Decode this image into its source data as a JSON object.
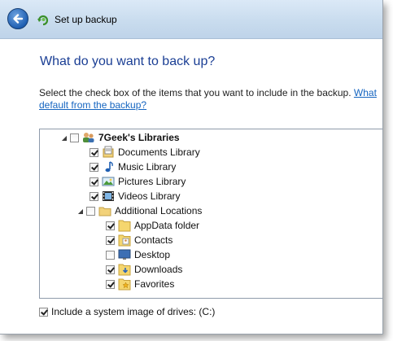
{
  "window": {
    "title": "Set up backup"
  },
  "main": {
    "heading": "What do you want to back up?",
    "instruction": "Select the check box of the items that you want to include in the backup.",
    "link_part1": "What",
    "link_part2": "default from the backup?"
  },
  "tree": {
    "root": {
      "label": "7Geek's Libraries",
      "checked": false,
      "expanded": true,
      "icon": "users-icon"
    },
    "libraries": [
      {
        "label": "Documents Library",
        "checked": true,
        "icon": "documents-icon"
      },
      {
        "label": "Music Library",
        "checked": true,
        "icon": "music-icon"
      },
      {
        "label": "Pictures Library",
        "checked": true,
        "icon": "pictures-icon"
      },
      {
        "label": "Videos Library",
        "checked": true,
        "icon": "videos-icon"
      }
    ],
    "additional": {
      "label": "Additional Locations",
      "checked": false,
      "expanded": true,
      "icon": "folder-icon"
    },
    "locations": [
      {
        "label": "AppData folder",
        "checked": true,
        "icon": "folder-icon"
      },
      {
        "label": "Contacts",
        "checked": true,
        "icon": "contacts-icon"
      },
      {
        "label": "Desktop",
        "checked": false,
        "icon": "desktop-icon"
      },
      {
        "label": "Downloads",
        "checked": true,
        "icon": "downloads-icon"
      },
      {
        "label": "Favorites",
        "checked": true,
        "icon": "favorites-icon"
      }
    ]
  },
  "system_image": {
    "label": "Include a system image of drives: (C:)",
    "checked": true
  },
  "colors": {
    "heading": "#1a3e94",
    "link": "#1565c0",
    "titlebar": "#c9dcee"
  }
}
